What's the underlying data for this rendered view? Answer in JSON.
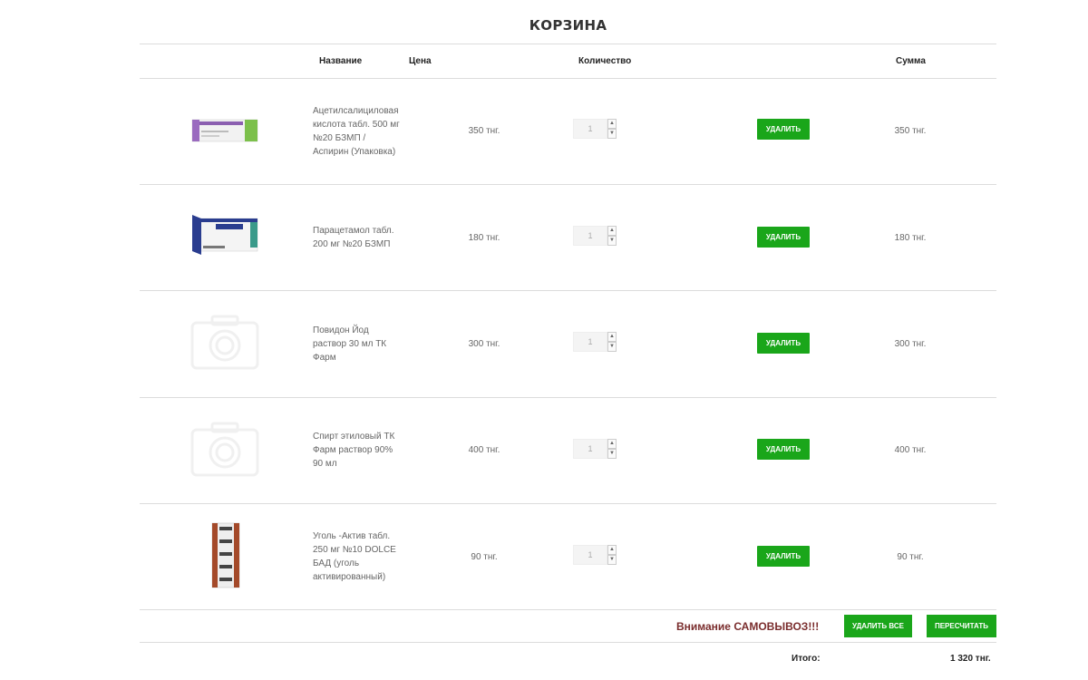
{
  "cart": {
    "title": "КОРЗИНА",
    "columns": {
      "name": "Название",
      "price": "Цена",
      "quantity": "Количество",
      "sum": "Сумма"
    },
    "delete_label": "УДАЛИТЬ",
    "items": [
      {
        "name": "Ацетилсалициловая кислота табл. 500 мг №20 БЗМП / Аспирин (Упаковка)",
        "price": "350 тнг.",
        "quantity": "1",
        "sum": "350 тнг.",
        "image": "aspirin-box"
      },
      {
        "name": "Парацетамол табл. 200 мг №20 БЗМП",
        "price": "180 тнг.",
        "quantity": "1",
        "sum": "180 тнг.",
        "image": "paracetamol-box"
      },
      {
        "name": "Повидон Йод раствор 30 мл ТК Фарм",
        "price": "300 тнг.",
        "quantity": "1",
        "sum": "300 тнг.",
        "image": "camera-placeholder"
      },
      {
        "name": "Спирт этиловый ТК Фарм раствор 90% 90 мл",
        "price": "400 тнг.",
        "quantity": "1",
        "sum": "400 тнг.",
        "image": "camera-placeholder"
      },
      {
        "name": "Уголь -Актив табл. 250 мг №10 DOLCE БАД (уголь активированный)",
        "price": "90 тнг.",
        "quantity": "1",
        "sum": "90 тнг.",
        "image": "charcoal-blister"
      }
    ],
    "footer": {
      "notice": "Внимание САМОВЫВОЗ!!!",
      "delete_all_label": "УДАЛИТЬ ВСЕ",
      "recalculate_label": "ПЕРЕСЧИТАТЬ",
      "total_label": "Итого:",
      "total_value": "1 320 тнг."
    }
  },
  "colors": {
    "button_green": "#1aa61a",
    "notice_red": "#7a2d2d",
    "divider": "#dcdcdc"
  }
}
